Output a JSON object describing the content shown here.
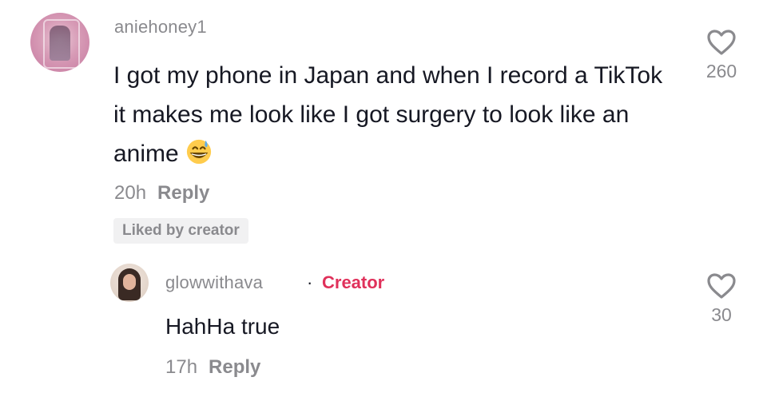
{
  "comment": {
    "username": "aniehoney1",
    "text": "I got my phone in Japan and when I record a TikTok it makes me look like I got surgery to look like an anime",
    "emoji_icon": "grinning-face-with-sweat-emoji",
    "time": "20h",
    "reply_label": "Reply",
    "liked_badge": "Liked by creator",
    "like_count": "260"
  },
  "reply": {
    "username": "glowwithava",
    "separator": "·",
    "role": "Creator",
    "text": "HahHa true",
    "time": "17h",
    "reply_label": "Reply",
    "like_count": "30"
  },
  "colors": {
    "text": "#161823",
    "muted": "#8a8a8e",
    "creator": "#e0315b",
    "badge_bg": "#f1f1f2"
  }
}
